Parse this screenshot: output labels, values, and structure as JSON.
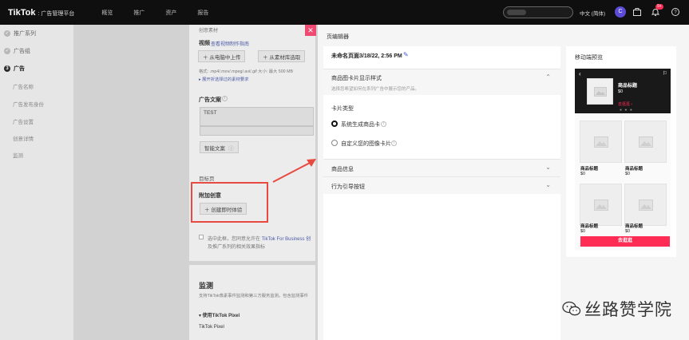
{
  "topbar": {
    "logo": "TikTok",
    "logo_sub": ": 广告管理平台",
    "nav": [
      "概览",
      "推广",
      "资产",
      "报告"
    ],
    "language": "中文 (简体)",
    "avatar_letter": "C",
    "badge": "9+"
  },
  "sidebar": {
    "items": [
      {
        "label": "推广系列",
        "marker": "✓"
      },
      {
        "label": "广告组",
        "marker": "✓"
      },
      {
        "label": "广告",
        "marker": "3"
      }
    ],
    "subitems": [
      "广告名称",
      "广告发布身份",
      "广告设置",
      "创意详情",
      "监测"
    ]
  },
  "form": {
    "header_text": "创意素材",
    "video_label": "视频",
    "video_link": "查看视频制作指南",
    "upload_btn": "从电脑中上传",
    "library_btn": "从素材库选取",
    "format_text": "格式: .mp4/.mov/.mpeg/.avi/.gif   大小: 最大 500 MB",
    "expand_link": "▸ 展开折选择过的素材要求",
    "copy_label": "广告文案",
    "copy_value": "TEST",
    "smart_copy_btn": "智能文案",
    "landing_label": "目标页",
    "addon_label": "附加创意",
    "instant_btn": "创建即时体验",
    "consent_text1": "选中此框，您同意允许在",
    "consent_link": "TikTok For Business 创",
    "consent_text2": "及推广系列的相关效果指标",
    "monitor_title": "监测",
    "monitor_desc": "支持TikTok像素事件监测和第三方服务监测。包含监测事件",
    "pixel_label": "▾ 使用TikTok Pixel",
    "pixel_sub": "TikTok Pixel"
  },
  "editor": {
    "title": "页编辑器",
    "page_name": "未命名页面3/18/22, 2:56 PM",
    "sections": {
      "card_style": "商品图卡片显示样式",
      "card_style_desc": "选择您希望如何在系列广告中展示您的产品。",
      "card_type": "卡片类型",
      "option_system": "系统生成商品卡",
      "option_custom": "自定义您的图像卡片",
      "product_info": "商品信息",
      "cta": "行为引导按钮"
    }
  },
  "preview": {
    "title": "移动端预览",
    "featured_name": "商品标题",
    "featured_price": "$0",
    "featured_btn": "去逛逛 ›",
    "dots": "● ● ●",
    "tiles": [
      {
        "name": "商品标题",
        "price": "$0"
      },
      {
        "name": "商品标题",
        "price": "$0"
      },
      {
        "name": "商品标题",
        "price": "$0"
      },
      {
        "name": "商品标题",
        "price": "$0"
      }
    ],
    "buy_btn": "去逛逛"
  },
  "watermark": {
    "text": "丝路赞学院"
  },
  "colors": {
    "accent": "#fe2c55",
    "annotation_red": "#e84a42",
    "link_blue": "#3a5bd6"
  }
}
